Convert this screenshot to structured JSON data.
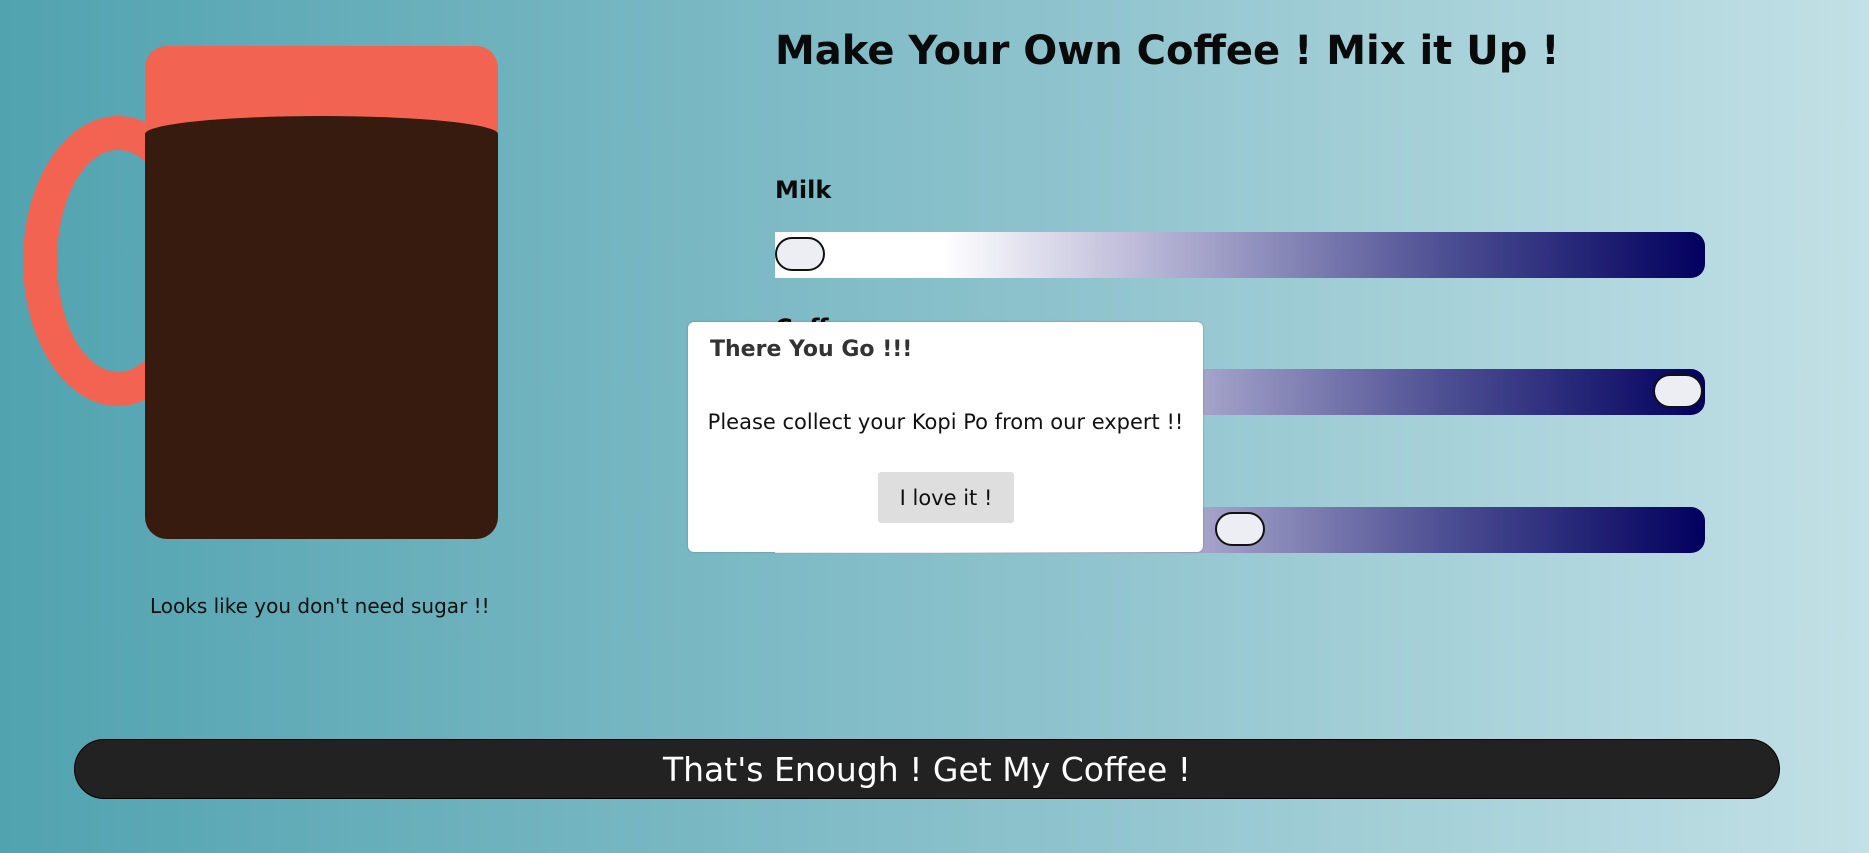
{
  "title": "Make Your Own Coffee ! Mix it Up !",
  "sliders": [
    {
      "label": "Milk",
      "value": 0.0
    },
    {
      "label": "Coff",
      "value": 1.0
    },
    {
      "label": "",
      "value": 0.5
    }
  ],
  "sugar_message": "Looks like you don't need sugar !!",
  "modal": {
    "title": "There You Go !!!",
    "message": "Please collect your Kopi Po from our expert !!",
    "button_label": "I love it !"
  },
  "action_button_label": "That's Enough ! Get My Coffee !",
  "colors": {
    "mug": "#f26451",
    "coffee": "#381b0f",
    "slider_end": "#02005e",
    "button_bg": "#222222"
  }
}
